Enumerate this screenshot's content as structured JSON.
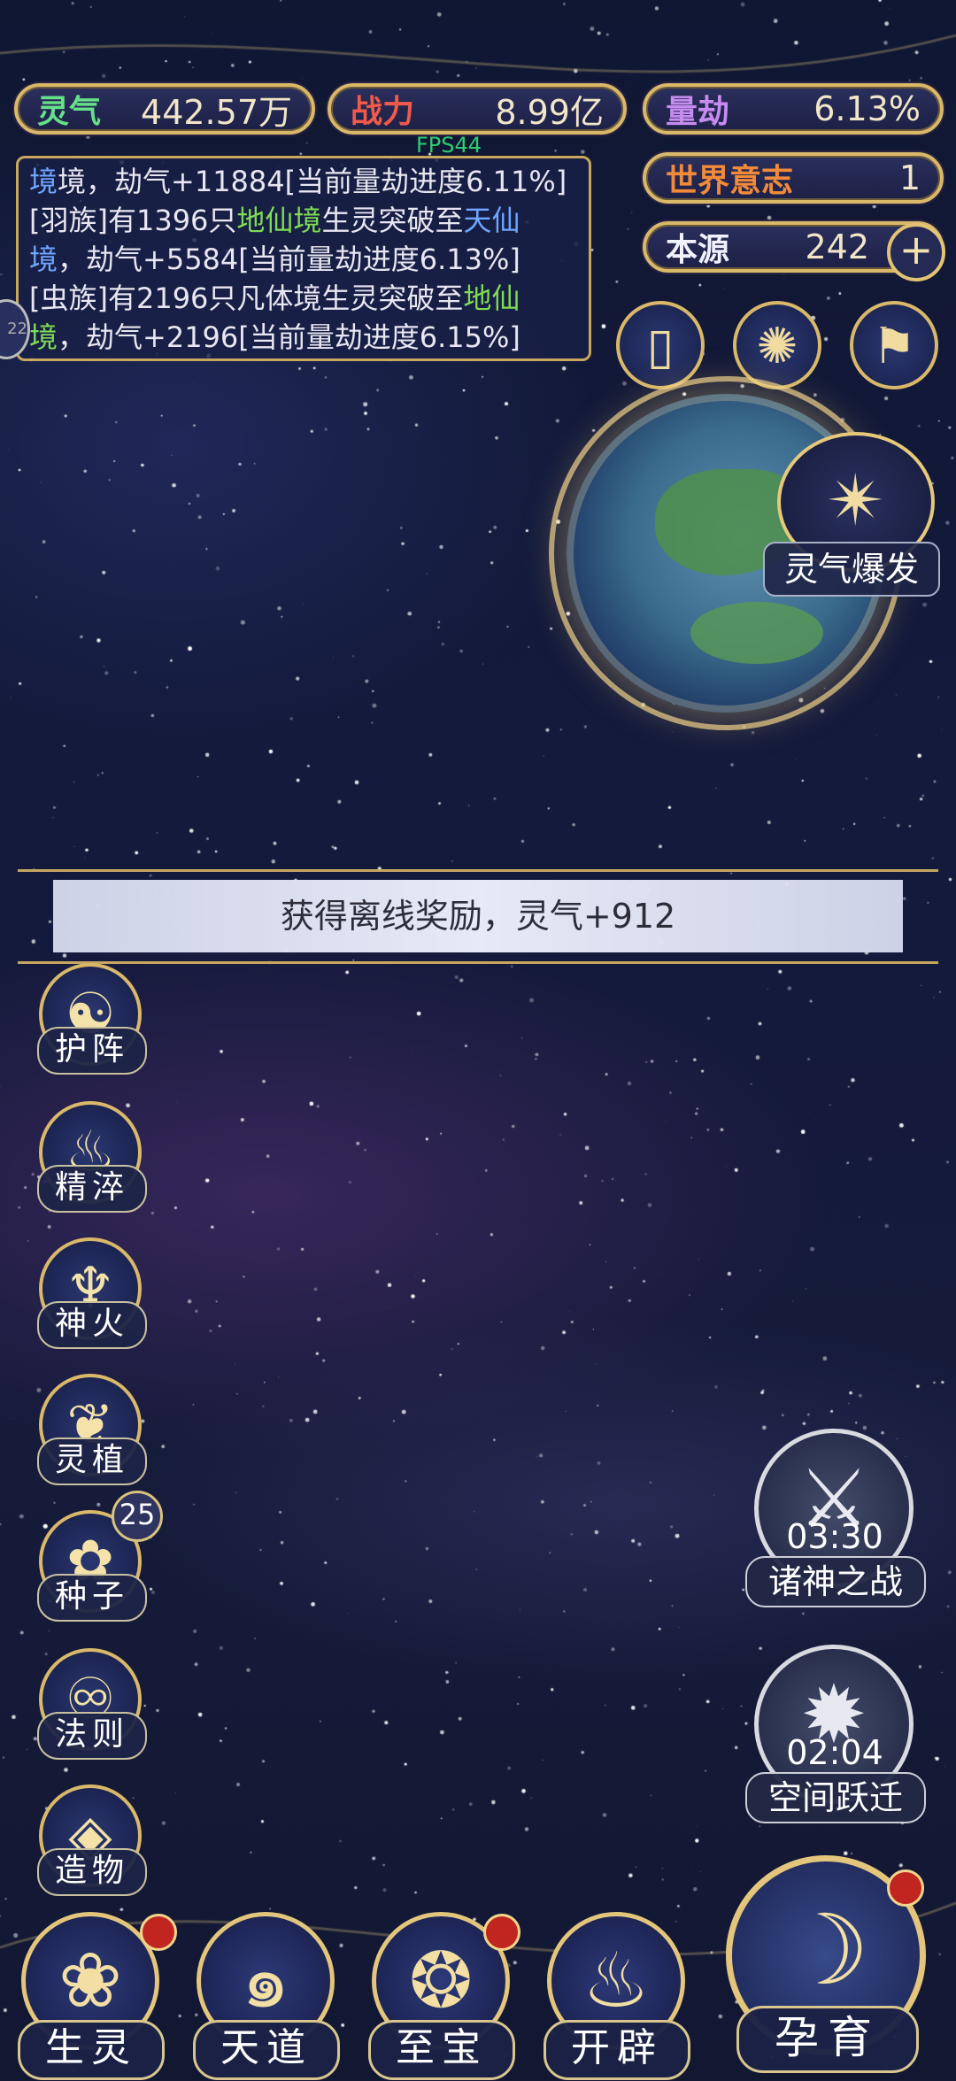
{
  "hud": {
    "lingqi": {
      "label": "灵气",
      "value": "442.57万",
      "color": "#67e08a"
    },
    "zhanli": {
      "label": "战力",
      "value": "8.99亿",
      "color": "#ef5a4a"
    },
    "liangjie": {
      "label": "量劫",
      "value": "6.13%",
      "color": "#c68cf0"
    },
    "shijie": {
      "label": "世界意志",
      "value": "1",
      "color": "#f08a3a"
    },
    "benyuan": {
      "label": "本源",
      "value": "242",
      "color": "#ffffff"
    },
    "fps": "FPS44"
  },
  "log": {
    "l1a": "境，劫气+11884[当前量劫进度6.11%]",
    "l2a": "[羽族]有1396只",
    "l2b": "地仙境",
    "l2c": "生灵突破至",
    "l2d": "天仙",
    "l3a": "境",
    "l3b": "，劫气+5584[当前量劫进度6.13%]",
    "l4a": "[虫族]有2196只凡体境生灵突破至",
    "l4b": "地仙",
    "l5a": "境",
    "l5b": "，劫气+2196[当前量劫进度6.15%]"
  },
  "left_stub": "22",
  "burst_label": "灵气爆发",
  "banner_text": "获得离线奖励，灵气+912",
  "side": [
    "护阵",
    "精淬",
    "神火",
    "灵植",
    "种子",
    "法则",
    "造物"
  ],
  "seed_badge": "25",
  "events": {
    "battle": {
      "time": "03:30",
      "name": "诸神之战"
    },
    "jump": {
      "time": "02:04",
      "name": "空间跃迁"
    }
  },
  "bottom": [
    "生灵",
    "天道",
    "至宝",
    "开辟"
  ],
  "hatch": "孕育"
}
